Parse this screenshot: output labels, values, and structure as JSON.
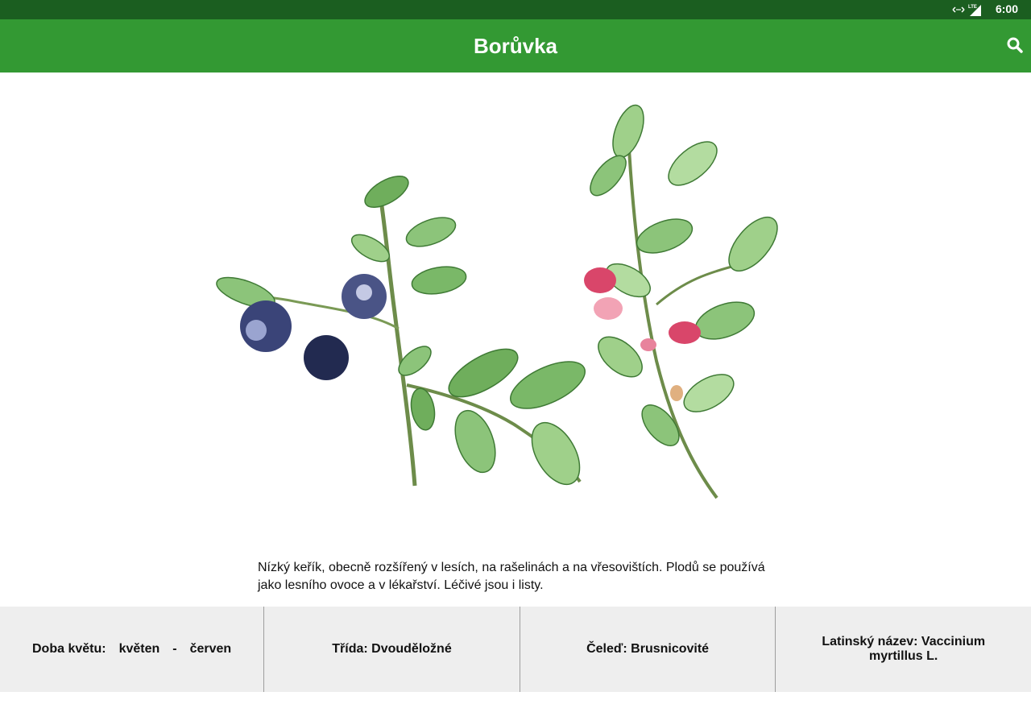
{
  "status_bar": {
    "time": "6:00",
    "icons": [
      "data-transfer-icon",
      "lte-signal-icon"
    ],
    "network_label": "LTE"
  },
  "app_bar": {
    "title": "Borůvka",
    "icon": "search-icon"
  },
  "plant": {
    "image": "blueberry-botanical-illustration",
    "description": "Nízký keřík, obecně rozšířený v lesích, na rašelinách a na vřesovištích. Plodů se používá jako lesního ovoce a v lékařství. Léčivé jsou i listy."
  },
  "info": {
    "bloom_label": "Doba květu:",
    "bloom_from": "květen",
    "bloom_sep": "-",
    "bloom_to": "červen",
    "class": "Třída: Dvouděložné",
    "family": "Čeleď: Brusnicovité",
    "latin": "Latinský název: Vaccinium myrtillus L."
  },
  "colors": {
    "status_bar": "#1b5e20",
    "app_bar": "#339933",
    "info_bar": "#eeeeee",
    "leaf": "#5a9e48",
    "berry": "#2b3560",
    "flower": "#d9466a"
  }
}
